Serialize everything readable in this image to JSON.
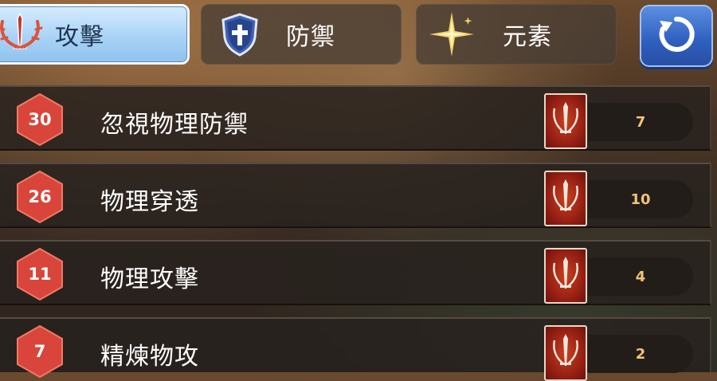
{
  "tabs": [
    {
      "id": "attack",
      "label": "攻擊",
      "icon": "sword-antler-icon",
      "active": true
    },
    {
      "id": "defense",
      "label": "防禦",
      "icon": "shield-cross-icon",
      "active": false
    },
    {
      "id": "element",
      "label": "元素",
      "icon": "star-sparkle-icon",
      "active": false
    }
  ],
  "refresh": {
    "icon": "refresh-icon"
  },
  "stats": [
    {
      "rank": "30",
      "name": "忽視物理防禦",
      "card_icon": "sword-card-icon",
      "value": "7"
    },
    {
      "rank": "26",
      "name": "物理穿透",
      "card_icon": "sword-card-icon",
      "value": "10"
    },
    {
      "rank": "11",
      "name": "物理攻擊",
      "card_icon": "sword-card-icon",
      "value": "4"
    },
    {
      "rank": "7",
      "name": "精煉物攻",
      "card_icon": "sword-card-icon",
      "value": "2"
    }
  ],
  "colors": {
    "active_tab": "#a9d3f6",
    "hex_badge": "#d9453a",
    "card_red": "#8f1c12",
    "value_text": "#f2c27a",
    "refresh_blue": "#2f5fbf"
  }
}
